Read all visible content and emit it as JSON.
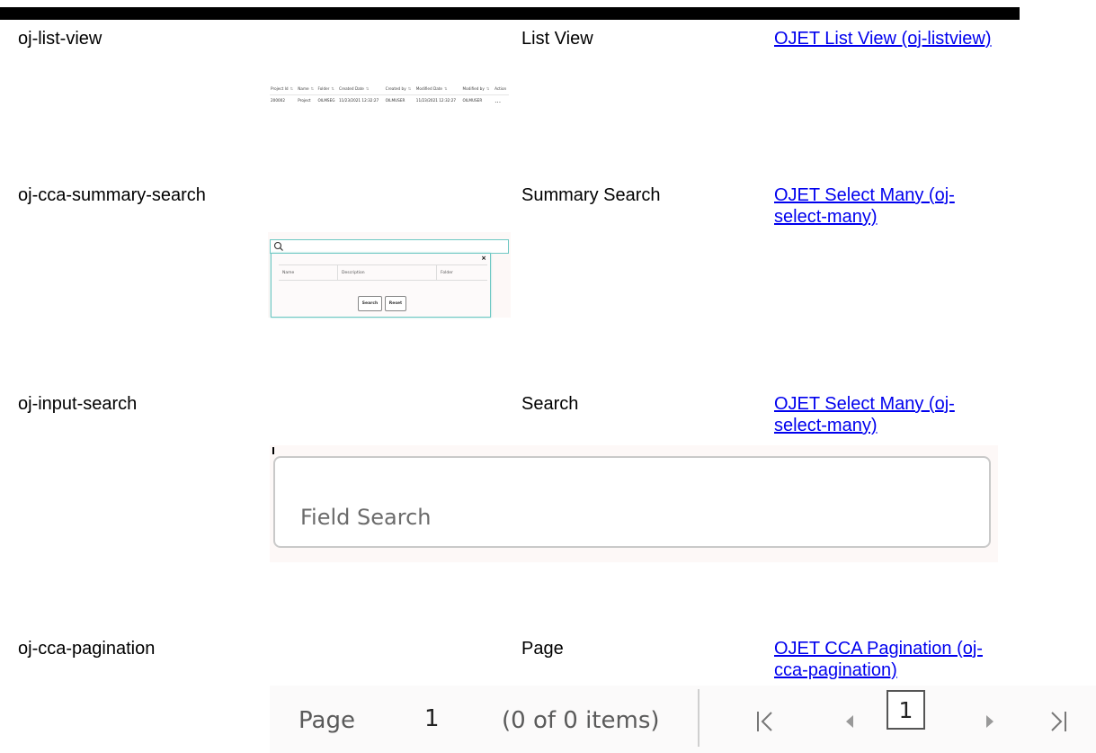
{
  "rows": [
    {
      "component": "oj-list-view",
      "description": "List View",
      "link": "OJET List View (oj-listview)"
    },
    {
      "component": "oj-cca-summary-search",
      "description": "Summary Search",
      "link": "OJET Select Many (oj-select-many)"
    },
    {
      "component": "oj-input-search",
      "description": "Search",
      "link": "OJET Select Many (oj-select-many)"
    },
    {
      "component": "oj-cca-pagination",
      "description": "Page",
      "link": "OJET CCA Pagination (oj-cca-pagination)"
    }
  ],
  "list_view_preview": {
    "headers": [
      "Project Id",
      "Name",
      "Folder",
      "Created Date",
      "Created by",
      "Modified Date",
      "Modified by",
      "Action"
    ],
    "row": [
      "200002",
      "Project",
      "OILMSEG",
      "11/23/2021 12:32:27",
      "OILMUSER",
      "11/23/2021 12:32:27",
      "OILMUSER",
      "…"
    ]
  },
  "summary_search_preview": {
    "columns": [
      "Name",
      "Description",
      "Folder"
    ],
    "search_button": "Search",
    "reset_button": "Reset",
    "close_glyph": "×"
  },
  "field_search_preview": {
    "placeholder": "Field Search"
  },
  "pagination_preview": {
    "page_label": "Page",
    "page_number": "1",
    "count_text": "(0 of 0 items)",
    "current_page": "1"
  }
}
